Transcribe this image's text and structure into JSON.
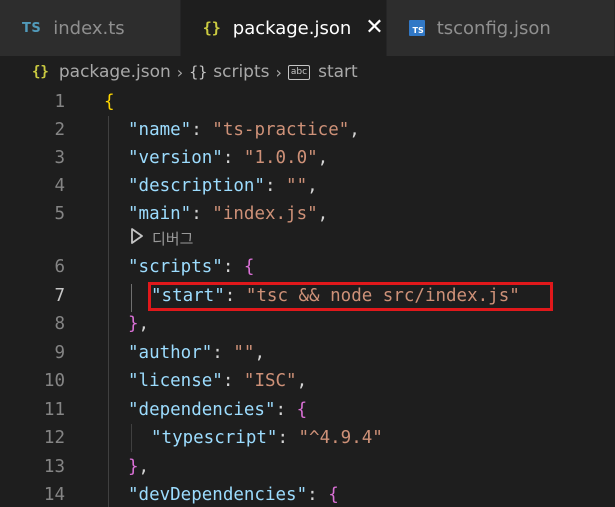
{
  "tabs": [
    {
      "icon": "TS",
      "label": "index.ts",
      "active": false
    },
    {
      "icon": "{}",
      "label": "package.json",
      "active": true
    },
    {
      "icon": "TS",
      "label": "tsconfig.json",
      "active": false
    }
  ],
  "breadcrumb": {
    "file": "package.json",
    "object": "scripts",
    "key": "start",
    "object_icon": "{}",
    "string_icon": "abc"
  },
  "codelens": {
    "label": "디버그",
    "icon": "play-icon"
  },
  "lines": [
    {
      "num": "1",
      "tokens": [
        {
          "t": "{",
          "c": "b1"
        }
      ]
    },
    {
      "num": "2",
      "tokens": [
        {
          "t": "\"name\"",
          "c": "k"
        },
        {
          "t": ": ",
          "c": "p"
        },
        {
          "t": "\"ts-practice\"",
          "c": "s"
        },
        {
          "t": ",",
          "c": "p"
        }
      ]
    },
    {
      "num": "3",
      "tokens": [
        {
          "t": "\"version\"",
          "c": "k"
        },
        {
          "t": ": ",
          "c": "p"
        },
        {
          "t": "\"1.0.0\"",
          "c": "s"
        },
        {
          "t": ",",
          "c": "p"
        }
      ]
    },
    {
      "num": "4",
      "tokens": [
        {
          "t": "\"description\"",
          "c": "k"
        },
        {
          "t": ": ",
          "c": "p"
        },
        {
          "t": "\"\"",
          "c": "s"
        },
        {
          "t": ",",
          "c": "p"
        }
      ]
    },
    {
      "num": "5",
      "tokens": [
        {
          "t": "\"main\"",
          "c": "k"
        },
        {
          "t": ": ",
          "c": "p"
        },
        {
          "t": "\"index.js\"",
          "c": "s"
        },
        {
          "t": ",",
          "c": "p"
        }
      ]
    },
    {
      "num": "6",
      "tokens": [
        {
          "t": "\"scripts\"",
          "c": "k"
        },
        {
          "t": ": ",
          "c": "p"
        },
        {
          "t": "{",
          "c": "b2"
        }
      ]
    },
    {
      "num": "7",
      "tokens": [
        {
          "t": "\"start\"",
          "c": "k"
        },
        {
          "t": ": ",
          "c": "p"
        },
        {
          "t": "\"tsc && node src/index.js\"",
          "c": "s"
        }
      ]
    },
    {
      "num": "8",
      "tokens": [
        {
          "t": "}",
          "c": "b2"
        },
        {
          "t": ",",
          "c": "p"
        }
      ]
    },
    {
      "num": "9",
      "tokens": [
        {
          "t": "\"author\"",
          "c": "k"
        },
        {
          "t": ": ",
          "c": "p"
        },
        {
          "t": "\"\"",
          "c": "s"
        },
        {
          "t": ",",
          "c": "p"
        }
      ]
    },
    {
      "num": "10",
      "tokens": [
        {
          "t": "\"license\"",
          "c": "k"
        },
        {
          "t": ": ",
          "c": "p"
        },
        {
          "t": "\"ISC\"",
          "c": "s"
        },
        {
          "t": ",",
          "c": "p"
        }
      ]
    },
    {
      "num": "11",
      "tokens": [
        {
          "t": "\"dependencies\"",
          "c": "k"
        },
        {
          "t": ": ",
          "c": "p"
        },
        {
          "t": "{",
          "c": "b2"
        }
      ]
    },
    {
      "num": "12",
      "tokens": [
        {
          "t": "\"typescript\"",
          "c": "k"
        },
        {
          "t": ": ",
          "c": "p"
        },
        {
          "t": "\"^4.9.4\"",
          "c": "s"
        }
      ]
    },
    {
      "num": "13",
      "tokens": [
        {
          "t": "}",
          "c": "b2"
        },
        {
          "t": ",",
          "c": "p"
        }
      ]
    },
    {
      "num": "14",
      "tokens": [
        {
          "t": "\"devDependencies\"",
          "c": "k"
        },
        {
          "t": ": ",
          "c": "p"
        },
        {
          "t": "{",
          "c": "b2"
        }
      ]
    }
  ],
  "colors": {
    "background": "#1e1e1e",
    "key": "#9cdcfe",
    "string": "#ce9178",
    "bracket_level1": "#ffd700",
    "bracket_level2": "#da70d6",
    "highlight_box": "#e0181b"
  }
}
